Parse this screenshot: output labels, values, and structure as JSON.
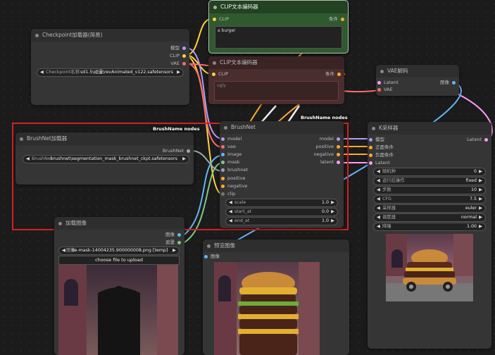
{
  "colors": {
    "clip_green": "#2f5a2f",
    "clip_red": "#4a2d2d",
    "model": "#b49bf5",
    "clip": "#ffd43b",
    "vae": "#ff6b6b",
    "conditioning": "#ffa931",
    "latent": "#ff9cf9",
    "image": "#64b5f6",
    "mask": "#81c784",
    "red_outline": "#d42020"
  },
  "nodes": {
    "clip_pos": {
      "title": "CLIP文本编码器",
      "in_clip": "CLIP",
      "out_cond": "条件",
      "text": "a burger"
    },
    "clip_neg": {
      "title": "CLIP文本编码器",
      "in_clip": "CLIP",
      "out_cond": "条件",
      "text": "ugly"
    },
    "checkpoint": {
      "title": "Checkpoint加载器(简易)",
      "out_model": "模型",
      "out_clip": "CLIP",
      "out_vae": "VAE",
      "widget_label": "Checkpoint名称",
      "widget_value": "sd1.5\\动漫\\revAnimated_v122.safetensors"
    },
    "vae_decode": {
      "title": "VAE解码",
      "in_latent": "Latent",
      "in_vae": "VAE",
      "out_image": "图像"
    },
    "brushnet_loader": {
      "title": "BrushNet加载器",
      "out": "BrushNet",
      "widget_label": "BrushNet",
      "widget_value": "brushnet\\segmentation_mask_brushnet_ckpt.safetensors"
    },
    "brushnet": {
      "title": "BrushNet",
      "inputs": [
        "model",
        "vae",
        "image",
        "mask",
        "brushnet",
        "positive",
        "negative",
        "clip"
      ],
      "outputs": [
        "model",
        "positive",
        "negative",
        "latent"
      ],
      "widgets": [
        {
          "label": "scale",
          "value": "1.0"
        },
        {
          "label": "start_at",
          "value": "0.0"
        },
        {
          "label": "end_at",
          "value": "1.0"
        }
      ]
    },
    "ksampler": {
      "title": "K采样器",
      "inputs": [
        "模型",
        "正面条件",
        "负面条件",
        "Latent"
      ],
      "output": "Latent",
      "widgets": [
        {
          "label": "随机种",
          "value": "0"
        },
        {
          "label": "运行后操作",
          "value": "fixed"
        },
        {
          "label": "步数",
          "value": "10"
        },
        {
          "label": "CFG",
          "value": "7.5"
        },
        {
          "label": "采样器",
          "value": "euler"
        },
        {
          "label": "调度器",
          "value": "normal"
        },
        {
          "label": "降噪",
          "value": "1.00"
        }
      ]
    },
    "load_image": {
      "title": "加载图像",
      "out_image": "图像",
      "out_mask": "遮罩",
      "widget_label": "图像",
      "widget_value": "ce-mask-14004235.900000008.png [temp]",
      "upload": "choose file to upload"
    },
    "preview": {
      "title": "预览图像",
      "in_image": "图像"
    }
  },
  "groups": {
    "brushname_top": "BrushName nodes",
    "brushname_box": "BrushName nodes"
  }
}
